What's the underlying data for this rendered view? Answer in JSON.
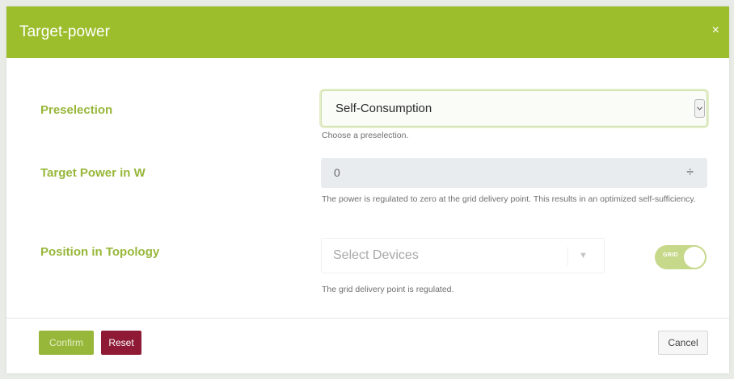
{
  "dialog": {
    "title": "Target-power",
    "close_glyph": "×"
  },
  "preselection": {
    "label": "Preselection",
    "value": "Self-Consumption",
    "help": "Choose a preselection.",
    "arrow_icon": "chevron-down-icon"
  },
  "target_power": {
    "label": "Target Power in W",
    "value": "0",
    "help": "The power is regulated to zero at the grid delivery point. This results in an optimized self-sufficiency.",
    "spinner_glyph": "÷"
  },
  "topology": {
    "label": "Position in Topology",
    "placeholder": "Select Devices",
    "dropdown_glyph": "▼",
    "toggle_text": "GRID",
    "toggle_on": true,
    "help": "The grid delivery point is regulated."
  },
  "footer": {
    "confirm_label": "Confirm",
    "reset_label": "Reset",
    "cancel_label": "Cancel"
  },
  "colors": {
    "brand_green": "#9cbe2c",
    "label_green": "#97b73a",
    "reset_red": "#8e1a35"
  }
}
